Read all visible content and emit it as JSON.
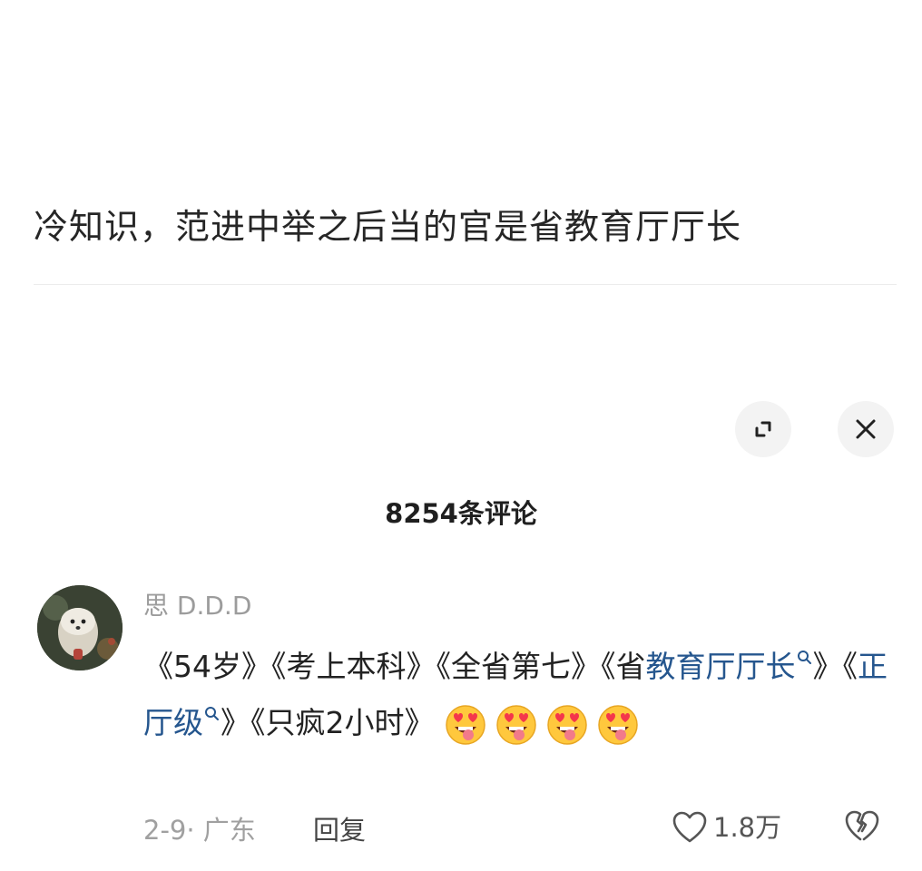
{
  "post": {
    "text": "冷知识，范进中举之后当的官是省教育厅厅长"
  },
  "panel": {
    "expand_icon": "expand-icon",
    "close_icon": "close-icon",
    "comment_count": "8254条评论"
  },
  "comment": {
    "username": "思 D.D.D",
    "parts": {
      "p1": "《54岁》《考上本科》《全省第七》《省",
      "kw1": "教育厅厅长",
      "p2": "》《",
      "kw2": "正厅级",
      "p3": "》《只疯2小时》"
    },
    "emoji_name": "star-struck-tongue-emoji",
    "emoji_count": 4,
    "meta": "2-9· 广东",
    "reply_label": "回复",
    "like_count": "1.8万"
  },
  "colors": {
    "keyword_link": "#25568e",
    "meta_text": "#a0a0a0",
    "button_bg": "#f3f3f3"
  }
}
